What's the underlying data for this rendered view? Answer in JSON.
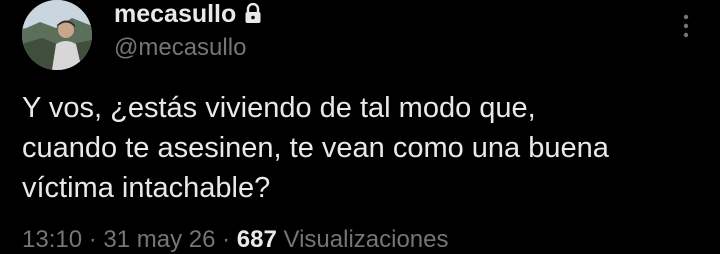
{
  "tweet": {
    "author": {
      "display_name": "mecasullo",
      "handle": "@mecasullo",
      "protected": true,
      "lock_icon": "lock-icon",
      "avatar_icon": "avatar"
    },
    "more_icon": "more-vertical-icon",
    "text_lines": [
      "Y vos, ¿estás viviendo de tal modo que,",
      "cuando te asesinen, te vean como una buena",
      "víctima intachable?"
    ],
    "meta": {
      "time": "13:10",
      "sep1": " · ",
      "date": "31 may 26",
      "sep2": " · ",
      "views_count": "687",
      "views_label": " Visualizaciones"
    }
  },
  "colors": {
    "background": "#000000",
    "primary_text": "#e7e9ea",
    "secondary_text": "#71767b"
  }
}
